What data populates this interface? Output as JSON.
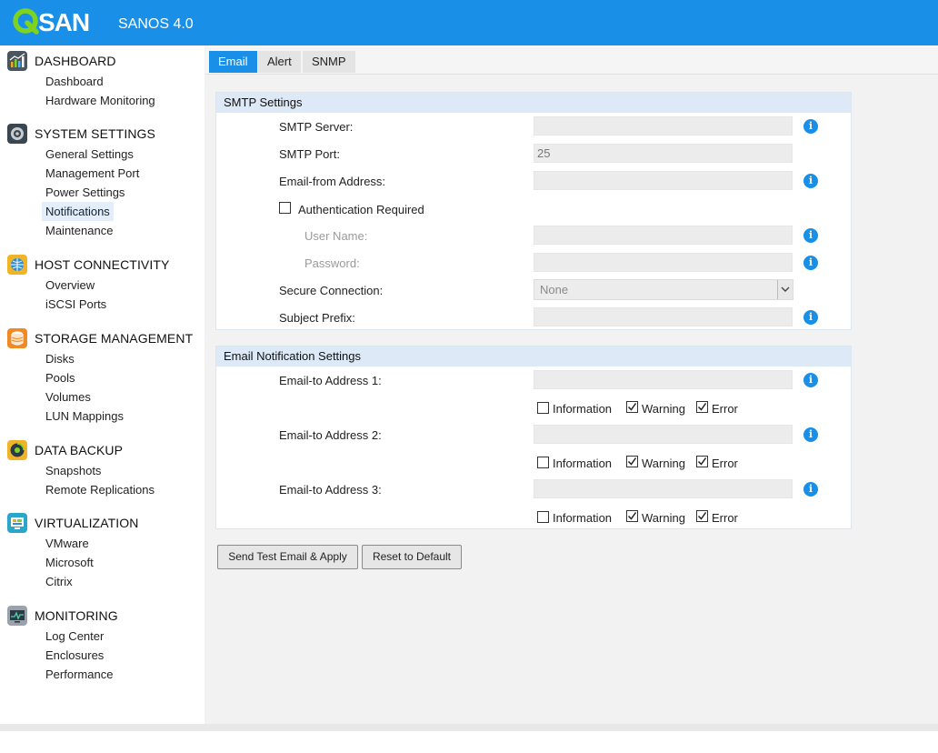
{
  "header": {
    "logo_text": "QSAN",
    "product_name": "SANOS 4.0",
    "bg_color": "#1a8fe8",
    "logo_accent": "#7ed321"
  },
  "sidebar": {
    "groups": [
      {
        "title": "DASHBOARD",
        "icon": "dashboard-chart-icon",
        "items": [
          {
            "label": "Dashboard"
          },
          {
            "label": "Hardware Monitoring"
          }
        ]
      },
      {
        "title": "SYSTEM SETTINGS",
        "icon": "system-settings-icon",
        "items": [
          {
            "label": "General Settings"
          },
          {
            "label": "Management Port"
          },
          {
            "label": "Power Settings"
          },
          {
            "label": "Notifications",
            "active": true
          },
          {
            "label": "Maintenance"
          }
        ]
      },
      {
        "title": "HOST CONNECTIVITY",
        "icon": "host-connectivity-icon",
        "items": [
          {
            "label": "Overview"
          },
          {
            "label": "iSCSI Ports"
          }
        ]
      },
      {
        "title": "STORAGE MANAGEMENT",
        "icon": "storage-management-icon",
        "items": [
          {
            "label": "Disks"
          },
          {
            "label": "Pools"
          },
          {
            "label": "Volumes"
          },
          {
            "label": "LUN Mappings"
          }
        ]
      },
      {
        "title": "DATA BACKUP",
        "icon": "data-backup-icon",
        "items": [
          {
            "label": "Snapshots"
          },
          {
            "label": "Remote Replications"
          }
        ]
      },
      {
        "title": "VIRTUALIZATION",
        "icon": "virtualization-icon",
        "items": [
          {
            "label": "VMware"
          },
          {
            "label": "Microsoft"
          },
          {
            "label": "Citrix"
          }
        ]
      },
      {
        "title": "MONITORING",
        "icon": "monitoring-icon",
        "items": [
          {
            "label": "Log Center"
          },
          {
            "label": "Enclosures"
          },
          {
            "label": "Performance"
          }
        ]
      }
    ]
  },
  "tabs": [
    {
      "label": "Email",
      "active": true
    },
    {
      "label": "Alert"
    },
    {
      "label": "SNMP"
    }
  ],
  "smtp": {
    "title": "SMTP Settings",
    "server_label": "SMTP Server:",
    "server_value": "",
    "port_label": "SMTP Port:",
    "port_value": "25",
    "from_label": "Email-from Address:",
    "from_value": "",
    "auth_label": "Authentication Required",
    "auth_checked": false,
    "username_label": "User Name:",
    "username_value": "",
    "password_label": "Password:",
    "password_value": "",
    "secure_label": "Secure Connection:",
    "secure_value": "None",
    "prefix_label": "Subject Prefix:",
    "prefix_value": ""
  },
  "notify": {
    "title": "Email Notification Settings",
    "level_labels": {
      "information": "Information",
      "warning": "Warning",
      "error": "Error"
    },
    "addresses": [
      {
        "label": "Email-to Address 1:",
        "value": "",
        "information": false,
        "warning": true,
        "error": true
      },
      {
        "label": "Email-to Address 2:",
        "value": "",
        "information": false,
        "warning": true,
        "error": true
      },
      {
        "label": "Email-to Address 3:",
        "value": "",
        "information": false,
        "warning": true,
        "error": true
      }
    ]
  },
  "buttons": {
    "send_test": "Send Test Email & Apply",
    "reset": "Reset to Default"
  },
  "info_glyph": "i"
}
